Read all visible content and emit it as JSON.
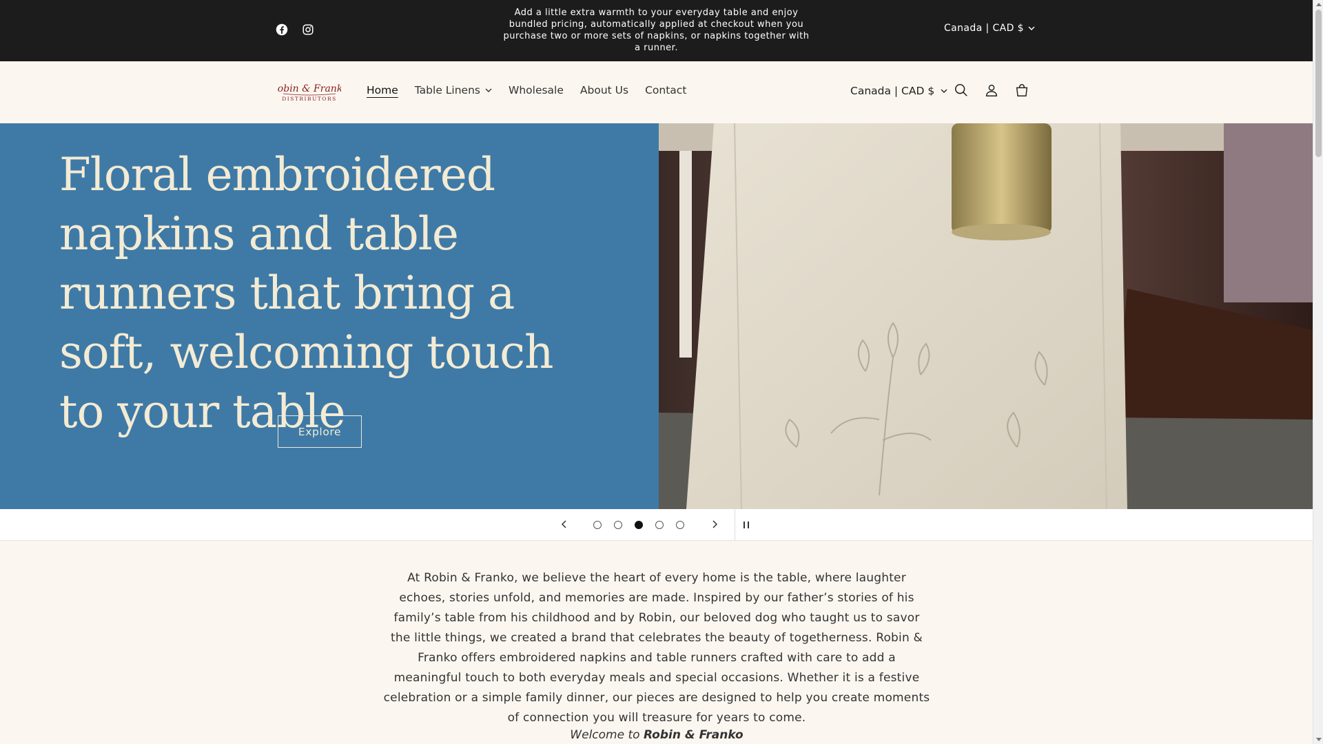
{
  "announcement": {
    "message": "Add a little extra warmth to your everyday table and enjoy bundled pricing, automatically applied at checkout when you purchase two or more sets of napkins, or napkins together with a runner.",
    "locale": "Canada | CAD $",
    "social": [
      "facebook-icon",
      "instagram-icon"
    ]
  },
  "brand": {
    "logo_line1": "Robin & Franko",
    "logo_line2": "DISTRIBUTORS",
    "logo_color": "#8a1f1f"
  },
  "nav": {
    "items": [
      {
        "label": "Home",
        "active": true
      },
      {
        "label": "Table Linens",
        "dropdown": true
      },
      {
        "label": "Wholesale"
      },
      {
        "label": "About Us"
      },
      {
        "label": "Contact"
      }
    ]
  },
  "header": {
    "locale": "Canada | CAD $",
    "icons": [
      "search-icon",
      "account-icon",
      "cart-icon"
    ]
  },
  "hero": {
    "heading": "Floral embroidered napkins and table runners that bring a soft, welcoming touch to your table",
    "button_label": "Explore",
    "bg_color": "#3f7aa6",
    "text_color": "#f3ebd4"
  },
  "slider": {
    "slide_count": 5,
    "active_slide": 3
  },
  "about": {
    "text": "At Robin & Franko, we believe the heart of every home is the table, where laughter echoes, stories unfold, and memories are made. Inspired by our father’s stories of his family’s table from his childhood and by Robin, our beloved dog who taught us to savor the little things, we created a brand that celebrates the beauty of togetherness. Robin & Franko offers embroidered napkins and table runners crafted with care to add a meaningful touch to both everyday meals and special occasions. Whether it is a festive celebration or a simple family dinner, our pieces are designed to help you create moments of connection you will treasure for years to come.",
    "welcome_prefix": "Welcome to",
    "welcome_brand": "Robin & Franko"
  }
}
